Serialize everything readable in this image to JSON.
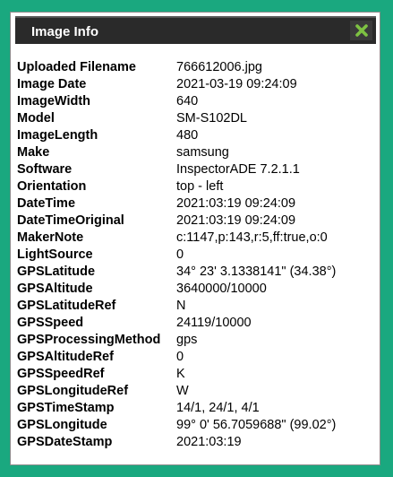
{
  "dialog": {
    "title": "Image Info",
    "close_icon": "close-x-icon",
    "close_color": "#7ec242"
  },
  "rows": [
    {
      "key": "Uploaded Filename",
      "value": "766612006.jpg"
    },
    {
      "key": "Image Date",
      "value": "2021-03-19 09:24:09"
    },
    {
      "key": "ImageWidth",
      "value": "640"
    },
    {
      "key": "Model",
      "value": "SM-S102DL"
    },
    {
      "key": "ImageLength",
      "value": "480"
    },
    {
      "key": "Make",
      "value": "samsung"
    },
    {
      "key": "Software",
      "value": "InspectorADE 7.2.1.1"
    },
    {
      "key": "Orientation",
      "value": "top - left"
    },
    {
      "key": "DateTime",
      "value": "2021:03:19 09:24:09"
    },
    {
      "key": "DateTimeOriginal",
      "value": "2021:03:19 09:24:09"
    },
    {
      "key": "MakerNote",
      "value": "c:1147,p:143,r:5,ff:true,o:0"
    },
    {
      "key": "LightSource",
      "value": "0"
    },
    {
      "key": "GPSLatitude",
      "value": "34° 23' 3.1338141\" (34.38°)"
    },
    {
      "key": "GPSAltitude",
      "value": "3640000/10000"
    },
    {
      "key": "GPSLatitudeRef",
      "value": "N"
    },
    {
      "key": "GPSSpeed",
      "value": "24119/10000"
    },
    {
      "key": "GPSProcessingMethod",
      "value": "gps"
    },
    {
      "key": "GPSAltitudeRef",
      "value": "0"
    },
    {
      "key": "GPSSpeedRef",
      "value": "K"
    },
    {
      "key": "GPSLongitudeRef",
      "value": "W"
    },
    {
      "key": "GPSTimeStamp",
      "value": "14/1, 24/1, 4/1"
    },
    {
      "key": "GPSLongitude",
      "value": "99° 0' 56.7059688\" (99.02°)"
    },
    {
      "key": "GPSDateStamp",
      "value": "2021:03:19"
    }
  ],
  "colors": {
    "background": "#1aa87f",
    "titlebar": "#2a2a2a"
  }
}
